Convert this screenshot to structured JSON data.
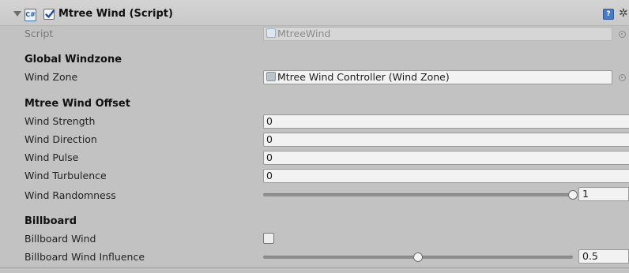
{
  "header": {
    "title": "Mtree Wind (Script)",
    "cs_icon_glyph": "C#",
    "help_icon_glyph": "?",
    "gear_icon_glyph": "✲",
    "enabled": true
  },
  "script_row": {
    "label": "Script",
    "value": "MtreeWind"
  },
  "global_windzone": {
    "heading": "Global Windzone",
    "wind_zone_label": "Wind Zone",
    "wind_zone_value": "Mtree Wind Controller (Wind Zone)"
  },
  "wind_offset": {
    "heading": "Mtree Wind Offset",
    "strength_label": "Wind Strength",
    "strength_value": "0",
    "direction_label": "Wind Direction",
    "direction_value": "0",
    "pulse_label": "Wind Pulse",
    "pulse_value": "0",
    "turbulence_label": "Wind Turbulence",
    "turbulence_value": "0",
    "randomness_label": "Wind Randomness",
    "randomness_value": "1",
    "randomness_fraction": 1.0
  },
  "billboard": {
    "heading": "Billboard",
    "wind_label": "Billboard Wind",
    "wind_checked": false,
    "influence_label": "Billboard Wind Influence",
    "influence_value": "0.5",
    "influence_fraction": 0.5
  },
  "colors": {
    "panel_background": "#c2c2c2",
    "field_background": "#f2f2f2",
    "checkmark": "#1f4f9a"
  }
}
